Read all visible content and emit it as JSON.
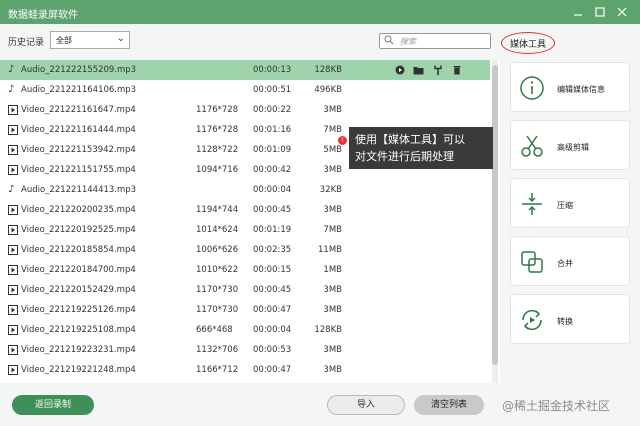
{
  "window": {
    "title": "数据蛙录屏软件"
  },
  "toolbar": {
    "history_label": "历史记录",
    "filter_value": "全部",
    "search_placeholder": "搜索",
    "media_tools_label": "媒体工具"
  },
  "files": [
    {
      "type": "audio",
      "name": "Audio_221222155209.mp3",
      "resolution": "",
      "duration": "00:00:13",
      "size": "128KB",
      "selected": true
    },
    {
      "type": "audio",
      "name": "Audio_221221164106.mp3",
      "resolution": "",
      "duration": "00:00:51",
      "size": "496KB"
    },
    {
      "type": "video",
      "name": "Video_221221161647.mp4",
      "resolution": "1176*728",
      "duration": "00:00:22",
      "size": "3MB"
    },
    {
      "type": "video",
      "name": "Video_221221161444.mp4",
      "resolution": "1176*728",
      "duration": "00:01:16",
      "size": "7MB"
    },
    {
      "type": "video",
      "name": "Video_221221153942.mp4",
      "resolution": "1128*722",
      "duration": "00:01:09",
      "size": "5MB"
    },
    {
      "type": "video",
      "name": "Video_221221151755.mp4",
      "resolution": "1094*716",
      "duration": "00:00:42",
      "size": "3MB"
    },
    {
      "type": "audio",
      "name": "Audio_221221144413.mp3",
      "resolution": "",
      "duration": "00:00:04",
      "size": "32KB"
    },
    {
      "type": "video",
      "name": "Video_221220200235.mp4",
      "resolution": "1194*744",
      "duration": "00:00:45",
      "size": "3MB"
    },
    {
      "type": "video",
      "name": "Video_221220192525.mp4",
      "resolution": "1014*624",
      "duration": "00:01:19",
      "size": "7MB"
    },
    {
      "type": "video",
      "name": "Video_221220185854.mp4",
      "resolution": "1006*626",
      "duration": "00:02:35",
      "size": "11MB"
    },
    {
      "type": "video",
      "name": "Video_221220184700.mp4",
      "resolution": "1010*622",
      "duration": "00:00:15",
      "size": "1MB"
    },
    {
      "type": "video",
      "name": "Video_221220152429.mp4",
      "resolution": "1170*730",
      "duration": "00:00:45",
      "size": "3MB"
    },
    {
      "type": "video",
      "name": "Video_221219225126.mp4",
      "resolution": "1170*730",
      "duration": "00:00:47",
      "size": "3MB"
    },
    {
      "type": "video",
      "name": "Video_221219225108.mp4",
      "resolution": "666*468",
      "duration": "00:00:04",
      "size": "128KB"
    },
    {
      "type": "video",
      "name": "Video_221219223231.mp4",
      "resolution": "1132*706",
      "duration": "00:00:53",
      "size": "3MB"
    },
    {
      "type": "video",
      "name": "Video_221219221248.mp4",
      "resolution": "1166*712",
      "duration": "00:00:47",
      "size": "3MB"
    }
  ],
  "tooltip": {
    "line1": "使用【媒体工具】可以",
    "line2": "对文件进行后期处理"
  },
  "tools": [
    {
      "label": "编辑媒体信息",
      "icon": "info-icon"
    },
    {
      "label": "高级剪辑",
      "icon": "scissors-icon"
    },
    {
      "label": "压缩",
      "icon": "compress-icon"
    },
    {
      "label": "合并",
      "icon": "merge-icon"
    },
    {
      "label": "转换",
      "icon": "convert-icon"
    }
  ],
  "bottom": {
    "back_label": "返回录制",
    "import_label": "导入",
    "clear_label": "清空列表",
    "watermark": "@稀土掘金技术社区"
  },
  "colors": {
    "titlebar": "#5da36d",
    "selected_row": "#9fd3ab",
    "back_button": "#3f8f58"
  }
}
